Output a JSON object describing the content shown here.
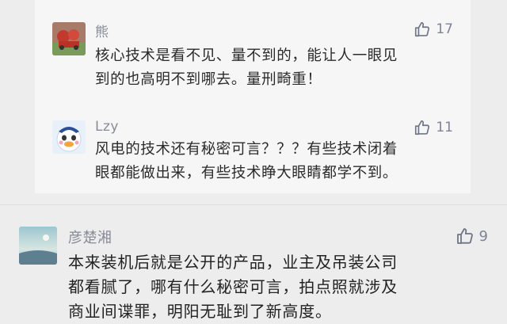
{
  "replies": [
    {
      "username": "熊",
      "likes": "17",
      "text_lines": [
        "核心技术是看不见、量不到的，能让人一眼见",
        "到的也高明不到哪去。量刑畸重！"
      ]
    },
    {
      "username": "Lzy",
      "likes": "11",
      "text_lines": [
        "风电的技术还有秘密可言？？？有些技术闭着",
        "眼都能做出来，有些技术睁大眼睛都学不到。"
      ]
    }
  ],
  "main_comment": {
    "username": "彦楚湘",
    "likes": "9",
    "text_lines": [
      "本来装机后就是公开的产品，业主及吊装公司",
      "都看腻了，哪有什么秘密可言，拍点照就涉及",
      "商业间谍罪，明阳无耻到了新高度。"
    ]
  },
  "colors": {
    "background": "#ededed",
    "reply_background": "#f6f6f6",
    "username": "#888c97",
    "like_icon": "#6d7586"
  }
}
